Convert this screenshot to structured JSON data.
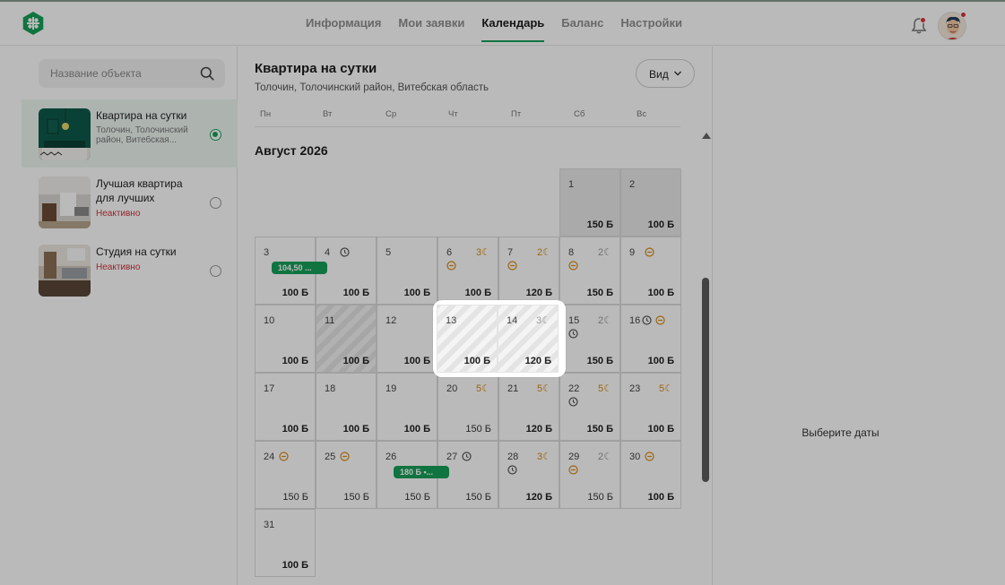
{
  "nav": {
    "items": [
      "Информация",
      "Мои заявки",
      "Календарь",
      "Баланс",
      "Настройки"
    ],
    "active": "Календарь"
  },
  "icons": {
    "logo": "clover-logo-icon",
    "notifications": "bell-icon",
    "profile": "avatar-icon",
    "search": "search-icon",
    "view": "chevron-down-icon"
  },
  "colors": {
    "accent": "#17a05a",
    "alert": "#e0303a",
    "night": "#d68a14",
    "inactive": "#d0333d"
  },
  "sidebar": {
    "search_placeholder": "Название объекта",
    "objects": [
      {
        "title": "Квартира на сутки",
        "subtitle": "Толочин, Толочинский район, Витебская...",
        "status": "",
        "selected": true
      },
      {
        "title": "Лучшая квартира для лучших",
        "subtitle": "",
        "status": "Неактивно",
        "selected": false
      },
      {
        "title": "Студия на сутки",
        "subtitle": "",
        "status": "Неактивно",
        "selected": false
      }
    ]
  },
  "calendar": {
    "title": "Квартира на сутки",
    "address": "Толочин, Толочинский район, Витебская область",
    "view_label": "Вид",
    "weekdays": [
      "Пн",
      "Вт",
      "Ср",
      "Чт",
      "Пт",
      "Сб",
      "Вс"
    ],
    "month": "Август 2026",
    "days": [
      {
        "day": "1",
        "price": "150 Б",
        "state": "gray"
      },
      {
        "day": "2",
        "price": "100 Б",
        "state": "gray"
      },
      {
        "day": "3",
        "price": "100 Б"
      },
      {
        "day": "4",
        "price": "100 Б"
      },
      {
        "day": "5",
        "price": "100 Б"
      },
      {
        "day": "6",
        "price": "100 Б",
        "nights": "3"
      },
      {
        "day": "7",
        "price": "120 Б",
        "nights": "2"
      },
      {
        "day": "8",
        "price": "150 Б",
        "nights": "2"
      },
      {
        "day": "9",
        "price": "100 Б"
      },
      {
        "day": "10",
        "price": "100 Б"
      },
      {
        "day": "11",
        "price": "100 Б",
        "state": "hatch"
      },
      {
        "day": "12",
        "price": "100 Б"
      },
      {
        "day": "13",
        "price": "100 Б",
        "state": "hatch"
      },
      {
        "day": "14",
        "price": "120 Б",
        "nights": "3",
        "state": "hatch"
      },
      {
        "day": "15",
        "price": "150 Б",
        "nights": "2"
      },
      {
        "day": "16",
        "price": "100 Б"
      },
      {
        "day": "17",
        "price": "100 Б"
      },
      {
        "day": "18",
        "price": "100 Б"
      },
      {
        "day": "19",
        "price": "100 Б"
      },
      {
        "day": "20",
        "price": "150 Б",
        "nights": "5"
      },
      {
        "day": "21",
        "price": "120 Б",
        "nights": "5"
      },
      {
        "day": "22",
        "price": "150 Б",
        "nights": "5"
      },
      {
        "day": "23",
        "price": "100 Б",
        "nights": "5"
      },
      {
        "day": "24",
        "price": "150 Б"
      },
      {
        "day": "25",
        "price": "150 Б"
      },
      {
        "day": "26",
        "price": "150 Б"
      },
      {
        "day": "27",
        "price": "150 Б"
      },
      {
        "day": "28",
        "price": "120 Б",
        "nights": "3"
      },
      {
        "day": "29",
        "price": "150 Б",
        "nights": "2"
      },
      {
        "day": "30",
        "price": "100 Б"
      },
      {
        "day": "31",
        "price": "100 Б"
      }
    ],
    "bookings": [
      "104,50 ...",
      "180 Б •..."
    ]
  },
  "details": {
    "hint": "Выберите даты"
  }
}
